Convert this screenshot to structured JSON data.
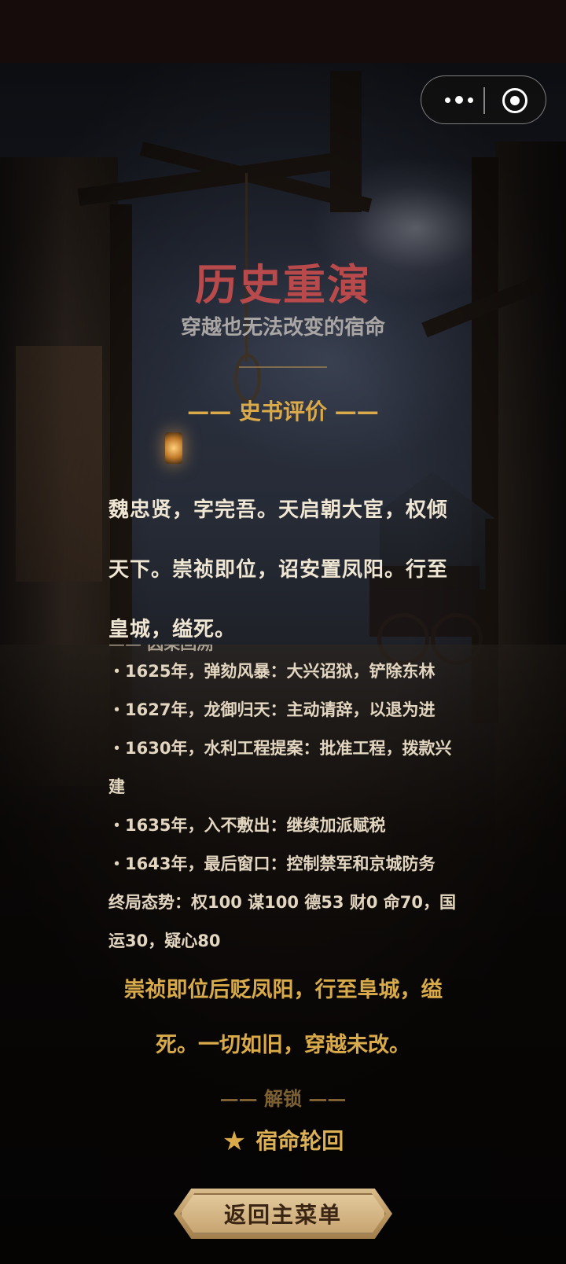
{
  "capsule": {
    "more_icon": "more-dots-icon",
    "close_icon": "target-circle-icon"
  },
  "header": {
    "title": "历史重演",
    "subtitle": "穿越也无法改变的宿命",
    "section": "—— 史书评价 ——"
  },
  "verdict": "魏忠贤，字完吾。天启朝大宦，权倾天下。崇祯即位，诏安置凤阳。行至皇城，缢死。",
  "timeline": {
    "heading": "—— 因果回溯",
    "events": [
      "・1625年，弹劾风暴：大兴诏狱，铲除东林",
      "・1627年，龙御归天：主动请辞，以退为进",
      "・1630年，水利工程提案：批准工程，拨款兴建",
      "・1635年，入不敷出：继续加派赋税",
      "・1643年，最后窗口：控制禁军和京城防务"
    ],
    "final_state": "终局态势：权100 谋100 德53 财0 命70，国运30，疑心80"
  },
  "ending": "崇祯即位后贬凤阳，行至阜城，缢死。一切如旧，穿越未改。",
  "unlock": {
    "heading": "—— 解锁 ——",
    "achievement": "宿命轮回",
    "star_icon": "star-icon"
  },
  "menu_button": "返回主菜单"
}
